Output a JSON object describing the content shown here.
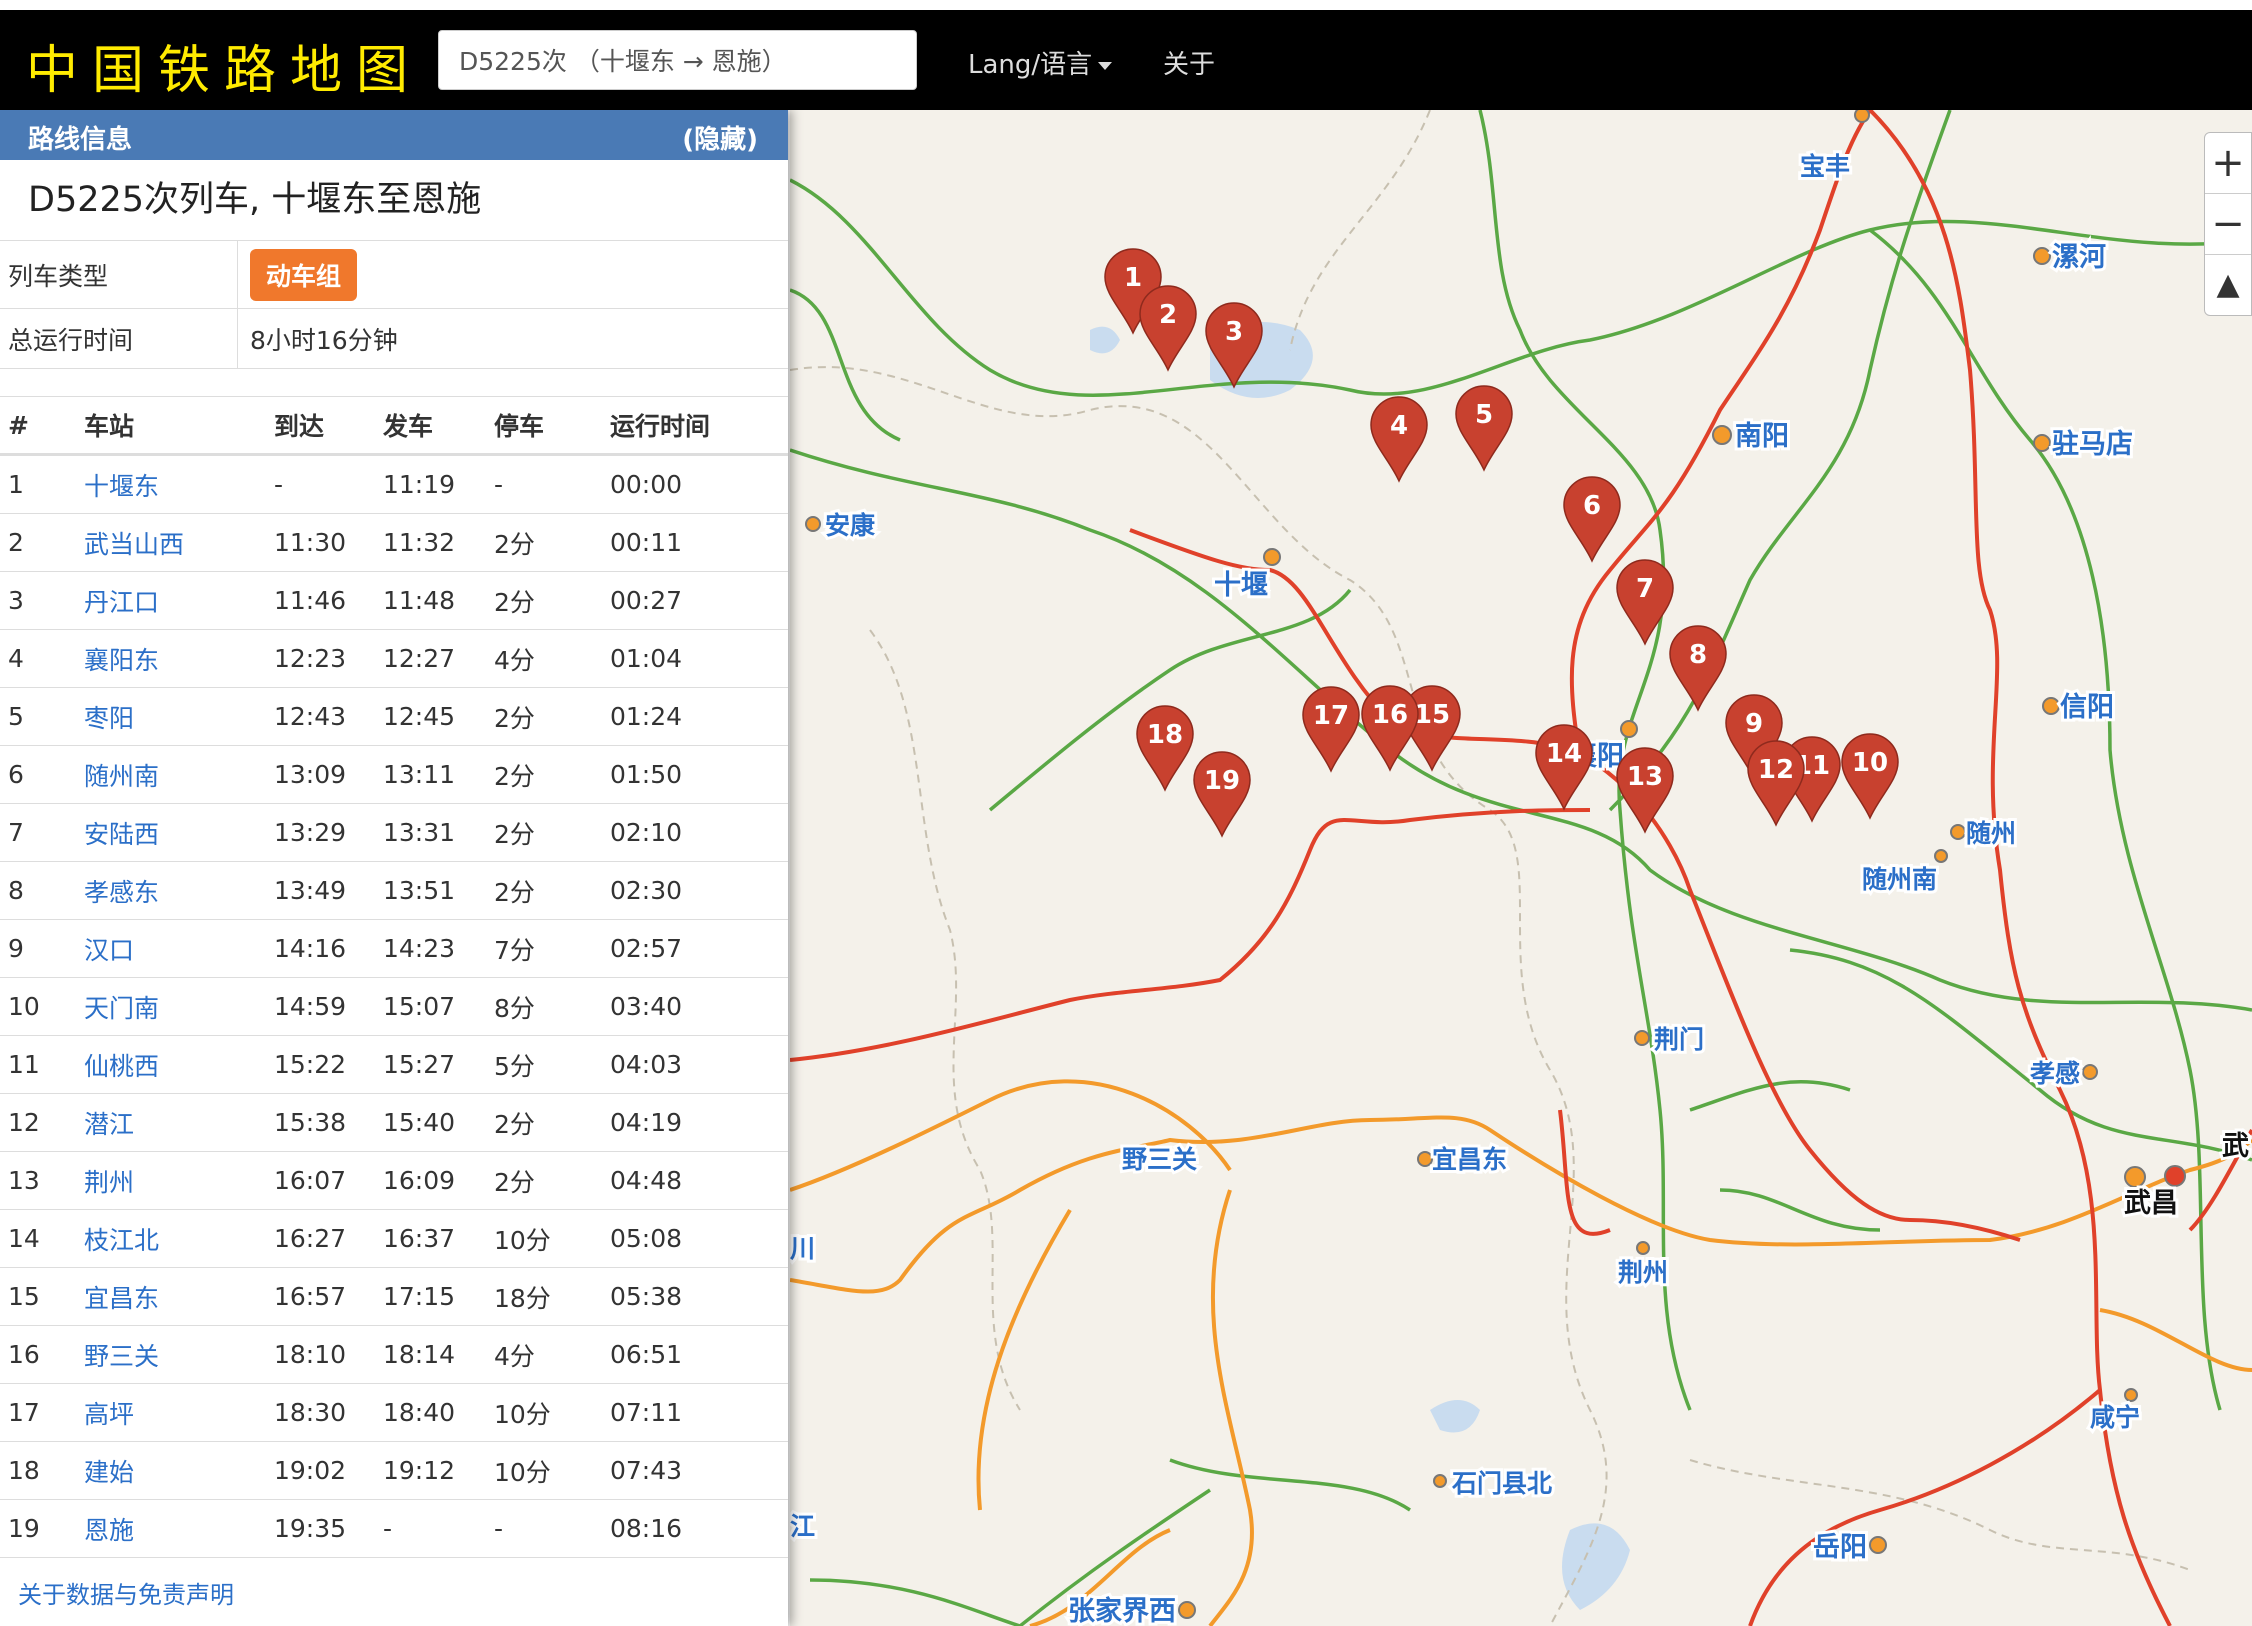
{
  "navbar": {
    "brand": "中国铁路地图",
    "search_value": "D5225次 （十堰东 → 恩施）",
    "lang_label": "Lang/语言",
    "about_label": "关于"
  },
  "panel": {
    "header_title": "路线信息",
    "hide_label": "(隐藏)",
    "train_title": "D5225次列车, 十堰东至恩施",
    "train_type_label": "列车类型",
    "train_type_value": "动车组",
    "total_time_label": "总运行时间",
    "total_time_value": "8小时16分钟",
    "columns": [
      "#",
      "车站",
      "到达",
      "发车",
      "停车",
      "运行时间"
    ],
    "stations": [
      [
        "1",
        "十堰东",
        "-",
        "11:19",
        "-",
        "00:00"
      ],
      [
        "2",
        "武当山西",
        "11:30",
        "11:32",
        "2分",
        "00:11"
      ],
      [
        "3",
        "丹江口",
        "11:46",
        "11:48",
        "2分",
        "00:27"
      ],
      [
        "4",
        "襄阳东",
        "12:23",
        "12:27",
        "4分",
        "01:04"
      ],
      [
        "5",
        "枣阳",
        "12:43",
        "12:45",
        "2分",
        "01:24"
      ],
      [
        "6",
        "随州南",
        "13:09",
        "13:11",
        "2分",
        "01:50"
      ],
      [
        "7",
        "安陆西",
        "13:29",
        "13:31",
        "2分",
        "02:10"
      ],
      [
        "8",
        "孝感东",
        "13:49",
        "13:51",
        "2分",
        "02:30"
      ],
      [
        "9",
        "汉口",
        "14:16",
        "14:23",
        "7分",
        "02:57"
      ],
      [
        "10",
        "天门南",
        "14:59",
        "15:07",
        "8分",
        "03:40"
      ],
      [
        "11",
        "仙桃西",
        "15:22",
        "15:27",
        "5分",
        "04:03"
      ],
      [
        "12",
        "潜江",
        "15:38",
        "15:40",
        "2分",
        "04:19"
      ],
      [
        "13",
        "荆州",
        "16:07",
        "16:09",
        "2分",
        "04:48"
      ],
      [
        "14",
        "枝江北",
        "16:27",
        "16:37",
        "10分",
        "05:08"
      ],
      [
        "15",
        "宜昌东",
        "16:57",
        "17:15",
        "18分",
        "05:38"
      ],
      [
        "16",
        "野三关",
        "18:10",
        "18:14",
        "4分",
        "06:51"
      ],
      [
        "17",
        "高坪",
        "18:30",
        "18:40",
        "10分",
        "07:11"
      ],
      [
        "18",
        "建始",
        "19:02",
        "19:12",
        "10分",
        "07:43"
      ],
      [
        "19",
        "恩施",
        "19:35",
        "-",
        "-",
        "08:16"
      ]
    ],
    "disclaimer": "关于数据与免责声明"
  },
  "map": {
    "zoom_in": "+",
    "zoom_out": "−",
    "north": "▲",
    "city_labels": [
      "宝丰",
      "漯河",
      "南阳",
      "驻马店",
      "安康",
      "十堰",
      "信阳",
      "襄阳",
      "随州",
      "随州南",
      "荆门",
      "孝感",
      "武",
      "武昌",
      "宜昌东",
      "野三关",
      "荆州",
      "川",
      "咸宁",
      "石门县北",
      "江",
      "岳阳",
      "张家界西"
    ],
    "marker_numbers": [
      "1",
      "2",
      "3",
      "4",
      "5",
      "6",
      "7",
      "8",
      "9",
      "10",
      "11",
      "12",
      "13",
      "14",
      "15",
      "16",
      "17",
      "18",
      "19"
    ],
    "colors": {
      "marker": "#c8412f",
      "railway_primary": "#e0412a",
      "railway_secondary": "#f39a2b",
      "highway": "#5aa845"
    }
  }
}
